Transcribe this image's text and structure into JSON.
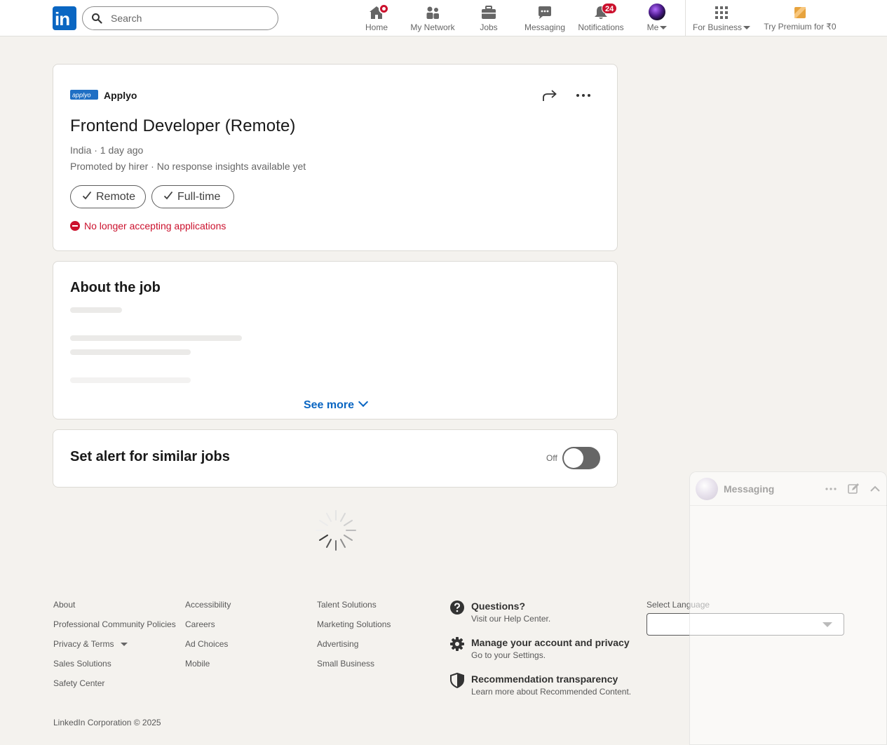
{
  "nav": {
    "logo_text": "in",
    "search_placeholder": "Search",
    "items": [
      {
        "label": "Home"
      },
      {
        "label": "My Network"
      },
      {
        "label": "Jobs"
      },
      {
        "label": "Messaging"
      },
      {
        "label": "Notifications",
        "badge": "24"
      },
      {
        "label": "Me"
      },
      {
        "label": "For Business"
      },
      {
        "label": "Try Premium for ₹0"
      }
    ]
  },
  "job": {
    "company": "Applyo",
    "company_logo_text": "applyo",
    "title": "Frontend Developer (Remote)",
    "meta_line1": "India · 1 day ago",
    "meta_line2": "Promoted by hirer · No response insights available yet",
    "pills": [
      "Remote",
      "Full-time"
    ],
    "status": "No longer accepting applications"
  },
  "about": {
    "title": "About the job",
    "see_more": "See more"
  },
  "alert": {
    "title": "Set alert for similar jobs",
    "toggle_label": "Off"
  },
  "footer": {
    "col1": [
      "About",
      "Professional Community Policies",
      "Privacy & Terms",
      "Sales Solutions",
      "Safety Center"
    ],
    "col2": [
      "Accessibility",
      "Careers",
      "Ad Choices",
      "Mobile"
    ],
    "col3": [
      "Talent Solutions",
      "Marketing Solutions",
      "Advertising",
      "Small Business"
    ],
    "help": [
      {
        "title": "Questions?",
        "sub": "Visit our Help Center."
      },
      {
        "title": "Manage your account and privacy",
        "sub": "Go to your Settings."
      },
      {
        "title": "Recommendation transparency",
        "sub": "Learn more about Recommended Content."
      }
    ],
    "language_label": "Select Language",
    "copyright": "LinkedIn Corporation © 2025"
  },
  "messaging": {
    "title": "Messaging"
  },
  "colors": {
    "brand": "#0a66c2",
    "alert_red": "#cb112d",
    "page_bg": "#f4f2ee"
  }
}
